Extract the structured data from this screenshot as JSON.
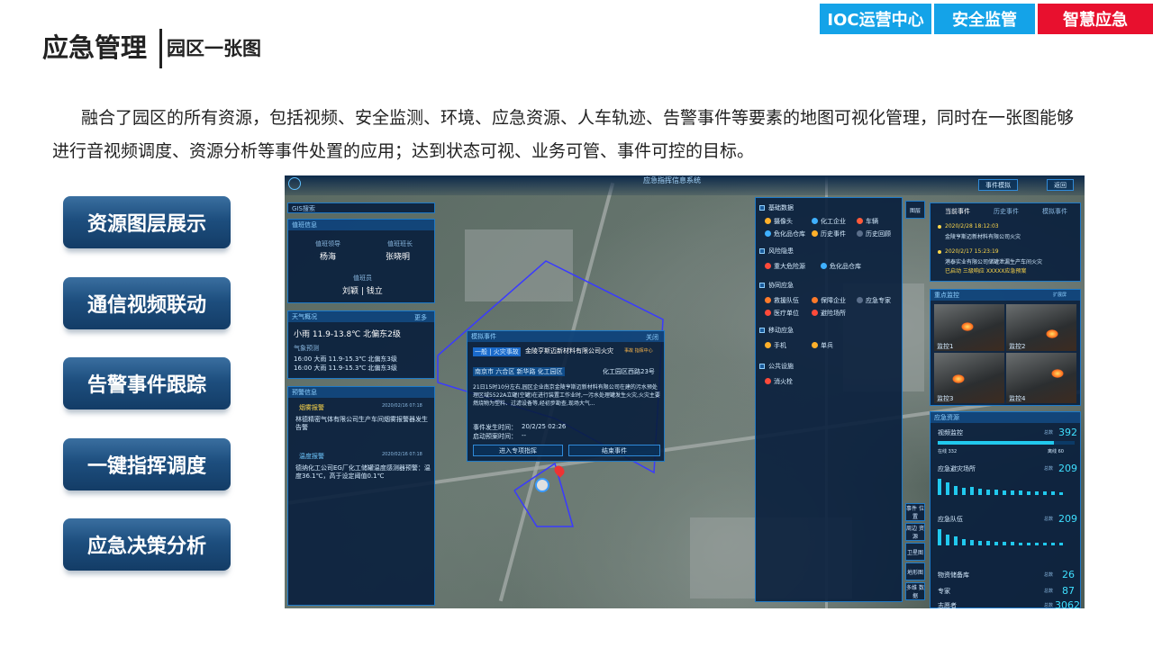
{
  "header_tabs": {
    "ioc": "IOC运营中心",
    "safety": "安全监管",
    "emergency": "智慧应急"
  },
  "title": {
    "main": "应急管理",
    "sub": "园区一张图"
  },
  "description": "融合了园区的所有资源，包括视频、安全监测、环境、应急资源、人车轨迹、告警事件等要素的地图可视化管理，同时在一张图能够进行音视频调度、资源分析等事件处置的应用；达到状态可视、业务可管、事件可控的目标。",
  "features": [
    "资源图层展示",
    "通信视频联动",
    "告警事件跟踪",
    "一键指挥调度",
    "应急决策分析"
  ],
  "screenshot": {
    "system_title": "应急指挥信息系统",
    "simulate_btn": "事件模拟",
    "back_btn": "返回",
    "search_placeholder": "GIS搜索",
    "duty": {
      "head": "值班信息",
      "leader_label": "值班领导",
      "leader": "杨海",
      "chief_label": "值班班长",
      "chief": "张晓明",
      "staff_label": "值班员",
      "staff": "刘颖 | 钱立"
    },
    "weather": {
      "head": "天气概况",
      "more": "更多",
      "now": "小雨  11.9-13.8℃  北偏东2级",
      "forecast_label": "气象预测",
      "row1": "16:00 大雨 11.9-15.3℃  北偏东3级",
      "row2": "16:00 大雨 11.9-15.3℃  北偏东3级"
    },
    "alerts": {
      "head": "预警信息",
      "a1_title": "烟雾报警",
      "a1_time": "2020/02/16 07:18",
      "a1_desc": "林德精密气体有限公司生产车间烟雾报警器发生告警",
      "a2_title": "温度报警",
      "a2_time": "2020/02/16 07:18",
      "a2_desc": "德纳化工公司EG厂化工储罐温度感测器预警：温度36.1℃，高于设定阈值0.1℃"
    },
    "event_popup": {
      "head": "模拟事件",
      "close": "关闭",
      "tag": "一般 | 火灾事故",
      "title": "金陵亨斯迈新材料有限公司火灾",
      "link": "事故 指挥中心",
      "location": "南京市 六合区 新华路 化工园区",
      "address": "化工园区西路23号",
      "detail": "21日15时10分左右,园区企业南京金陵亨斯迈新材料有限公司在建的污水预处理区域5522A立罐(空罐)在进行装置工作业时,一污水处理罐发生火灾,火灾主要燃烧物为塑料、过滤设备等,经初步勘查,现场大气...",
      "time_label": "事件发生时间：",
      "time": "20/2/25 02:26",
      "plan_label": "启动预案时间：",
      "plan": "--",
      "btn_plan": "进入专项指挥",
      "btn_end": "结束事件"
    },
    "layers": {
      "basic": "基础数据",
      "camera": "摄像头",
      "chem_ent": "化工企业",
      "vehicle": "车辆",
      "dangerous": "危化品仓库",
      "history": "历史事件",
      "track": "历史回顾",
      "risk": "风险隐患",
      "major_hazard": "重大危险源",
      "chem_warehouse": "危化品仓库",
      "coordination": "协同应急",
      "rescue": "救援队伍",
      "key_ent": "保障企业",
      "expert": "应急专家",
      "medical": "医疗单位",
      "shelter": "避险场所",
      "mobile": "移动应急",
      "phone": "手机",
      "individual": "单兵",
      "public": "公共设施",
      "hydrant": "消火栓"
    },
    "tabs_right": {
      "current": "当前事件",
      "history": "历史事件",
      "simulate": "模拟事件"
    },
    "events": [
      {
        "time": "2020/2/28 18:12:03",
        "desc": "金陵亨斯迈新材料有限公司火灾"
      },
      {
        "time": "2020/2/17 15:23:19",
        "desc": "港泰实业有限公司储罐泄漏生产车间火灾",
        "status": "已启动 三级响应 XXXXX应急预案"
      }
    ],
    "monitor": {
      "head": "重点监控",
      "expand": "扩展屏",
      "cams": [
        "监控1",
        "监控2",
        "监控3",
        "监控4"
      ]
    },
    "resources": {
      "head": "应急资源",
      "video_label": "视频监控",
      "total": "总数",
      "video_total": "392",
      "online": "在线 332",
      "offline": "离线 60",
      "places_label": "应急避灾场所",
      "places_total": "209",
      "teams_label": "应急队伍",
      "teams_total": "209",
      "materials_label": "物资储备库",
      "materials_total": "26",
      "experts_label": "专家",
      "experts_total": "87",
      "plans_label": "志愿者",
      "plans_total": "3062"
    },
    "side_tabs": [
      "图层",
      "事件\n位置",
      "周边\n资源",
      "卫星图",
      "地形图",
      "多维\n数据"
    ]
  }
}
